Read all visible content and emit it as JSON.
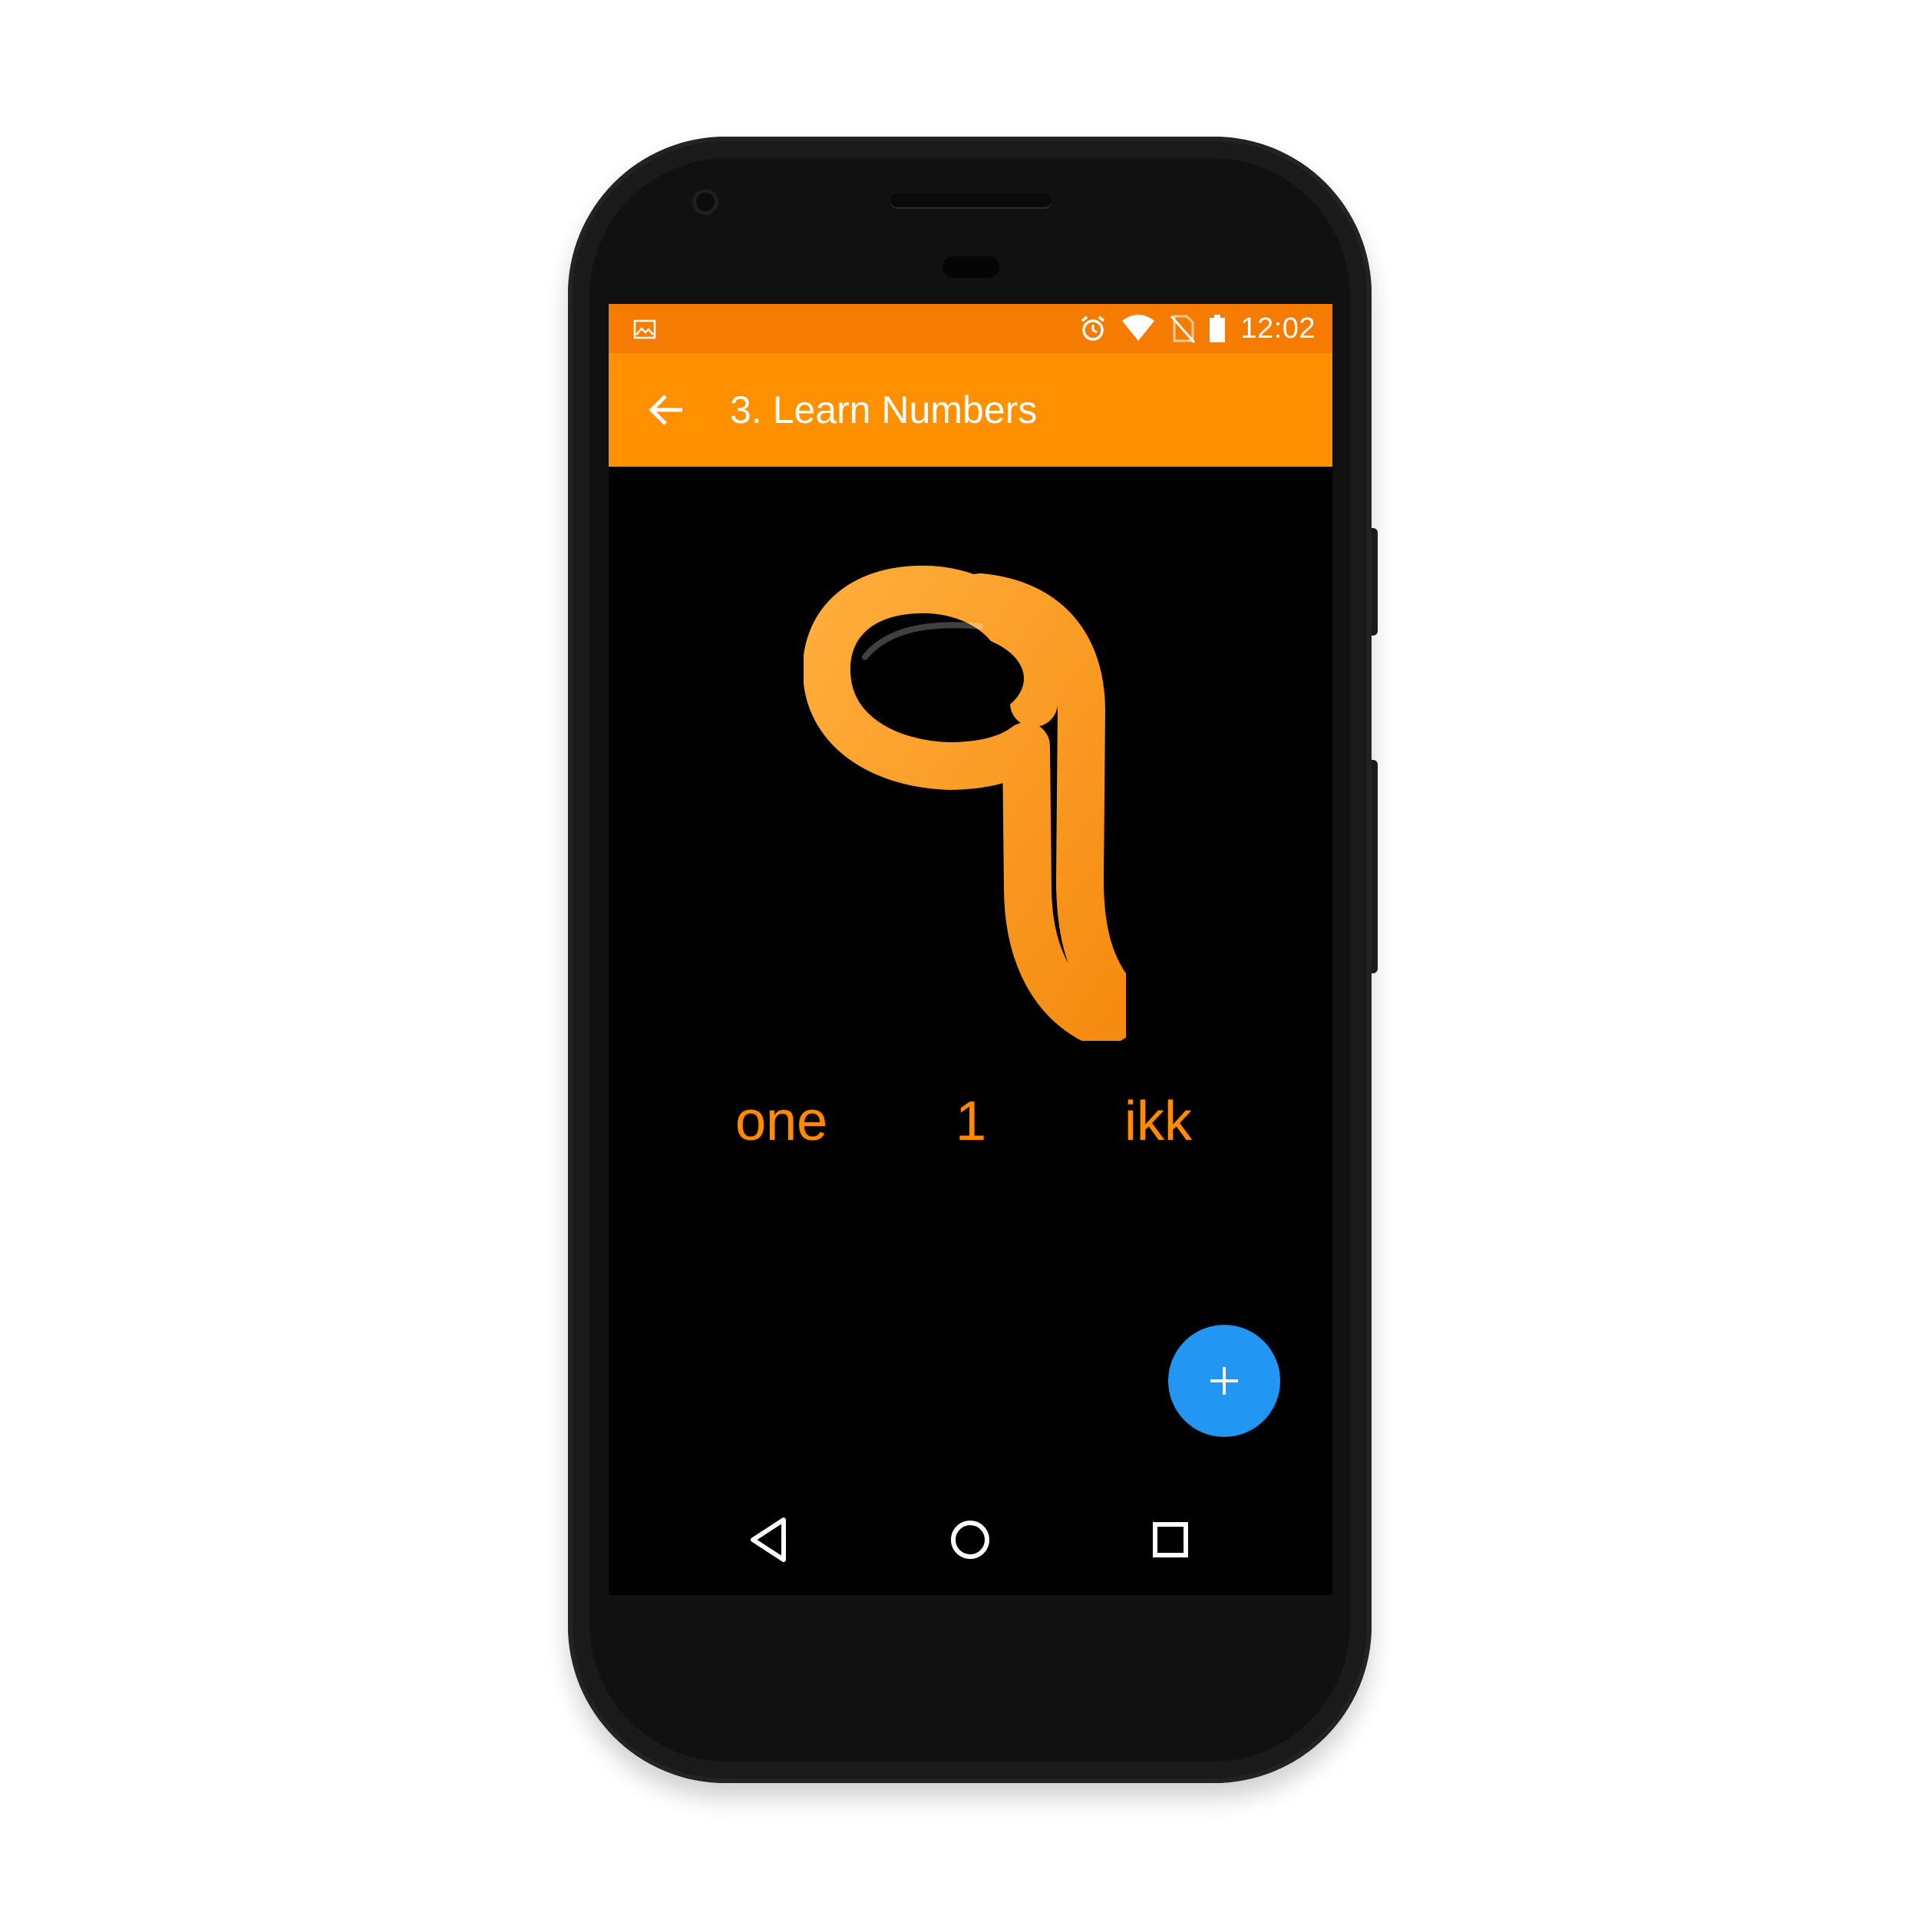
{
  "status_bar": {
    "time": "12:02",
    "left_icon": "image-notification-icon",
    "icons": [
      "alarm-icon",
      "wifi-icon",
      "no-sim-icon",
      "battery-icon"
    ],
    "color": "#f57c00"
  },
  "app_bar": {
    "title": "3. Learn Numbers",
    "back_icon": "back-arrow-icon",
    "color": "#ff9000"
  },
  "content": {
    "gurmukhi_numeral_icon": "gurmukhi-numeral-one-icon",
    "english_word": "one",
    "digit": "1",
    "punjabi_transliteration": "ikk",
    "text_color": "#ff8c00"
  },
  "fab": {
    "icon": "plus-icon",
    "color": "#2196f3"
  },
  "navigation": {
    "back": "nav-back-icon",
    "home": "nav-home-icon",
    "recents": "nav-recents-icon"
  }
}
